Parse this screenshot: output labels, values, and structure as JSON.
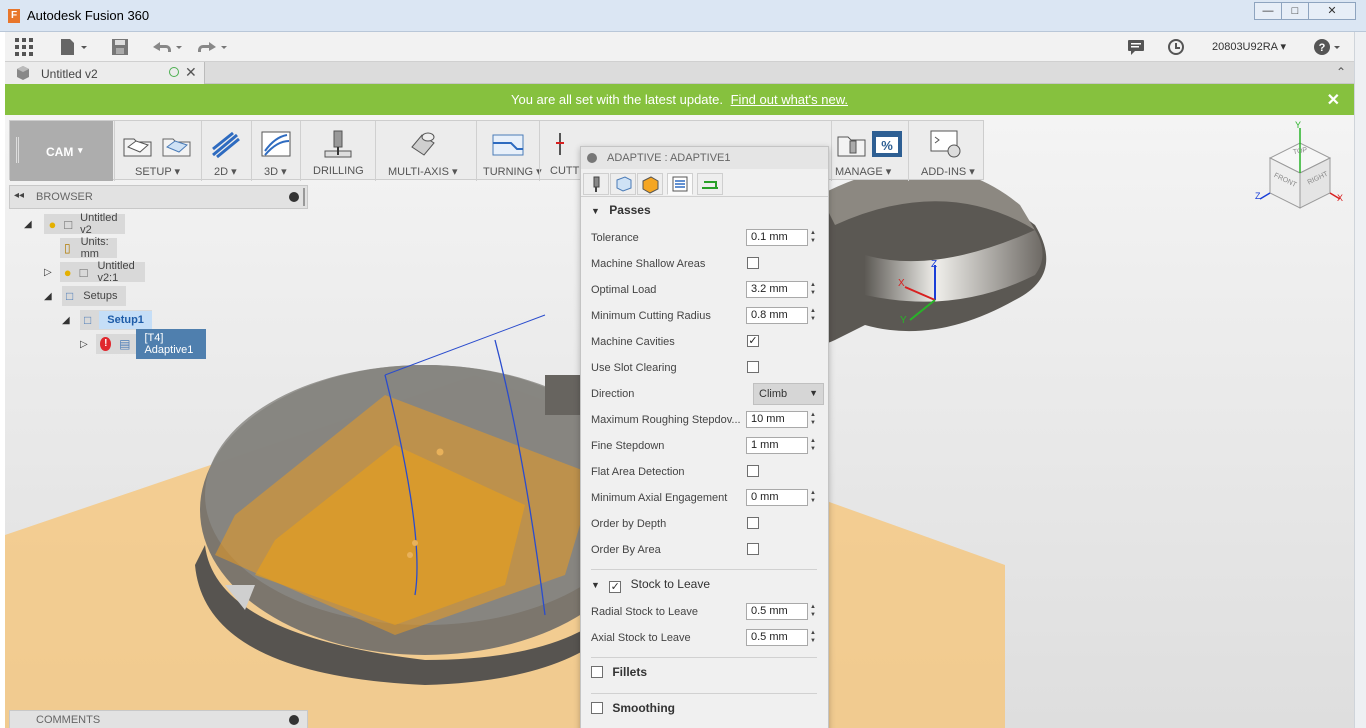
{
  "window": {
    "title": "Autodesk Fusion 360",
    "logo_letter": "F",
    "controls": [
      "minimize-icon",
      "maximize-icon",
      "close-icon"
    ]
  },
  "menubar": {
    "user": "20803U92RA",
    "icons": [
      "apps-grid-icon",
      "file-icon",
      "save-icon",
      "undo-icon",
      "redo-icon",
      "comments-icon",
      "history-icon",
      "help-icon"
    ]
  },
  "document_tab": {
    "label": "Untitled v2"
  },
  "notification": {
    "text": "You are all set with the latest update.",
    "link": "Find out what's new."
  },
  "toolbar": {
    "workspace": "CAM",
    "groups": [
      {
        "label": "SETUP"
      },
      {
        "label": "2D"
      },
      {
        "label": "3D"
      },
      {
        "label": "DRILLING"
      },
      {
        "label": "MULTI-AXIS"
      },
      {
        "label": "TURNING"
      },
      {
        "label": "CUTTI"
      },
      {
        "label": "MANAGE"
      },
      {
        "label": "ADD-INS"
      }
    ]
  },
  "browser": {
    "title": "BROWSER",
    "items": [
      {
        "label": "Untitled v2"
      },
      {
        "label": "Units: mm"
      },
      {
        "label": "Untitled v2:1"
      },
      {
        "label": "Setups"
      },
      {
        "label": "Setup1"
      },
      {
        "label": "[T4] Adaptive1"
      }
    ]
  },
  "comments": {
    "title": "COMMENTS"
  },
  "panel": {
    "title": "ADAPTIVE : ADAPTIVE1",
    "tabs": [
      "tool-tab-icon",
      "geometry-tab-icon",
      "heights-tab-icon",
      "passes-tab-icon",
      "linking-tab-icon"
    ],
    "passes_title": "Passes",
    "fields": {
      "tolerance": {
        "label": "Tolerance",
        "value": "0.1 mm"
      },
      "machine_shallow": {
        "label": "Machine Shallow Areas",
        "checked": false
      },
      "optimal_load": {
        "label": "Optimal Load",
        "value": "3.2 mm"
      },
      "min_cut_radius": {
        "label": "Minimum Cutting Radius",
        "value": "0.8 mm"
      },
      "machine_cavities": {
        "label": "Machine Cavities",
        "checked": true
      },
      "slot_clearing": {
        "label": "Use Slot Clearing",
        "checked": false
      },
      "direction": {
        "label": "Direction",
        "value": "Climb"
      },
      "max_stepdown": {
        "label": "Maximum Roughing Stepdov...",
        "value": "10 mm"
      },
      "fine_stepdown": {
        "label": "Fine Stepdown",
        "value": "1 mm"
      },
      "flat_area": {
        "label": "Flat Area Detection",
        "checked": false
      },
      "min_axial": {
        "label": "Minimum Axial Engagement",
        "value": "0 mm"
      },
      "order_depth": {
        "label": "Order by Depth",
        "checked": false
      },
      "order_area": {
        "label": "Order By Area",
        "checked": false
      }
    },
    "stock_title": "Stock to Leave",
    "stock_checked": true,
    "stock_fields": {
      "radial": {
        "label": "Radial Stock to Leave",
        "value": "0.5 mm"
      },
      "axial": {
        "label": "Axial Stock to Leave",
        "value": "0.5 mm"
      }
    },
    "fillets_title": "Fillets",
    "smoothing_title": "Smoothing"
  },
  "viewcube": {
    "top": "TOP",
    "front": "FRONT",
    "right": "RIGHT",
    "axes": {
      "x": "X",
      "y": "Y",
      "z": "Z"
    }
  },
  "triad": {
    "x": "X",
    "y": "Y",
    "z": "Z"
  }
}
